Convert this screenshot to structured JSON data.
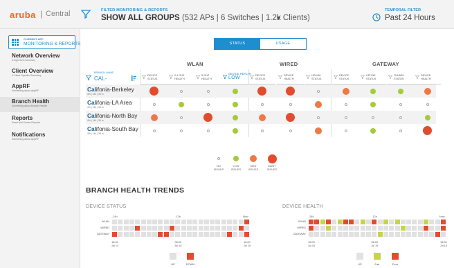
{
  "brand": {
    "logo": "aruba",
    "separator": "|",
    "product": "Central"
  },
  "header": {
    "filter_title": "FILTER MONITORING & REPORTS",
    "filter_main": "SHOW ALL GROUPS",
    "filter_detail": "(532 APs | 6 Switches | 1.2k Clients)",
    "filter_caret": "▼",
    "time_title": "TEMPORAL FILTER",
    "time_main": "Past 24 Hours"
  },
  "sidebar": {
    "app_button": {
      "sub": "CURRENT APP",
      "label": "MONITORING & REPORTS"
    },
    "items": [
      {
        "title": "Network Overview",
        "sub": "A high level summary"
      },
      {
        "title": "Client Overview",
        "sub": "A Client Specific Summary"
      },
      {
        "title": "AppRF",
        "sub": "Something about AppRF"
      },
      {
        "title": "Branch Health",
        "sub": "Something about Branch Health"
      },
      {
        "title": "Reports",
        "sub": "Read and Create Reports"
      },
      {
        "title": "Notifications",
        "sub": "Something about AppRF"
      }
    ]
  },
  "tabs": {
    "status": "STATUS",
    "usage": "USAGE"
  },
  "groups": {
    "wlan": "WLAN",
    "wired": "WIRED",
    "gateway": "GATEWAY"
  },
  "table": {
    "branch_header": {
      "label": "BRANCH NAME",
      "value": "CAL-"
    },
    "columns": [
      {
        "line1": "DEVICE",
        "line2": "STATUS",
        "highlight": false
      },
      {
        "line1": "2.4 GHZ",
        "line2": "HEALTH",
        "highlight": false
      },
      {
        "line1": "5 GHZ",
        "line2": "HEALTH",
        "highlight": false
      },
      {
        "line1": "DEVICE HEALTH",
        "line2": "LOW",
        "highlight": true
      },
      {
        "line1": "DEVICE",
        "line2": "STATUS",
        "highlight": false
      },
      {
        "line1": "DEVICE",
        "line2": "HEALTH",
        "highlight": false
      },
      {
        "line1": "UPLINK",
        "line2": "STATUS",
        "highlight": false
      },
      {
        "line1": "DEVICE",
        "line2": "STATUS",
        "highlight": false
      },
      {
        "line1": "UPLINK",
        "line2": "STATUS",
        "highlight": false
      },
      {
        "line1": "TUNNEL",
        "line2": "STATUS",
        "highlight": false
      },
      {
        "line1": "DEVICE",
        "line2": "HEALTH",
        "highlight": false
      }
    ],
    "rows": [
      {
        "prefix": "Cal",
        "name": "ifonia-Berkeley",
        "meta": "4% | 14h | 35 m",
        "cells": [
          "many",
          "none",
          "none",
          "low",
          "many",
          "many",
          "none",
          "med",
          "low",
          "low",
          "med"
        ]
      },
      {
        "prefix": "Cal",
        "name": "ifonia-LA Area",
        "meta": "4% | 14h | 35 m",
        "cells": [
          "none",
          "low",
          "none",
          "low",
          "none",
          "none",
          "med",
          "none",
          "low",
          "none",
          "none"
        ]
      },
      {
        "prefix": "Cal",
        "name": "ifonia-North Bay",
        "meta": "4% | 14h | 35 m",
        "cells": [
          "med",
          "none",
          "many",
          "low",
          "med",
          "many",
          "none",
          "none",
          "none",
          "none",
          "low"
        ]
      },
      {
        "prefix": "Cal",
        "name": "ifonia-South Bay",
        "meta": "4% | 14h | 35 m",
        "cells": [
          "none",
          "none",
          "none",
          "low",
          "none",
          "none",
          "med",
          "none",
          "low",
          "none",
          "many"
        ]
      }
    ]
  },
  "legend": [
    {
      "level": "none",
      "line1": "NO",
      "line2": "ISSUES"
    },
    {
      "level": "low",
      "line1": "LOW",
      "line2": "ISSUES"
    },
    {
      "level": "med",
      "line1": "MED",
      "line2": "ISSUES"
    },
    {
      "level": "many",
      "line1": "MANY",
      "line2": "ISSUES"
    }
  ],
  "trends": {
    "title": "BRANCH HEALTH TRENDS",
    "device_status": {
      "title": "DEVICE STATUS",
      "timeline": {
        "start": "-24h",
        "mid": "-12h",
        "end": "Now"
      },
      "rows": [
        {
          "label": "WLAN",
          "cells": [
            "u",
            "u",
            "u",
            "u",
            "u",
            "u",
            "u",
            "u",
            "u",
            "u",
            "u",
            "u",
            "u",
            "u",
            "u",
            "u",
            "u",
            "u",
            "u",
            "u",
            "u",
            "u",
            "u",
            "d"
          ]
        },
        {
          "label": "WIRED",
          "cells": [
            "u",
            "u",
            "u",
            "u",
            "d",
            "u",
            "u",
            "u",
            "u",
            "u",
            "d",
            "u",
            "u",
            "u",
            "u",
            "u",
            "u",
            "u",
            "u",
            "u",
            "u",
            "u",
            "d",
            "u"
          ]
        },
        {
          "label": "GATEWAY",
          "cells": [
            "d",
            "u",
            "u",
            "u",
            "u",
            "u",
            "u",
            "u",
            "d",
            "d",
            "u",
            "u",
            "u",
            "u",
            "u",
            "u",
            "u",
            "u",
            "u",
            "u",
            "d",
            "u",
            "u",
            "d"
          ]
        }
      ],
      "axis": [
        {
          "time": "18:00",
          "date": "Jul 14"
        },
        {
          "time": "06:00",
          "date": "Jul 15"
        },
        {
          "time": "18:00",
          "date": "Jul 15"
        }
      ],
      "legend": [
        {
          "key": "u",
          "label": "UP",
          "color": "#e1e1e1"
        },
        {
          "key": "d",
          "label": "DOWN",
          "color": "#e34b2e"
        }
      ]
    },
    "device_health": {
      "title": "DEVICE HEALTH",
      "timeline": {
        "start": "-24h",
        "mid": "-12h",
        "end": "Now"
      },
      "rows": [
        {
          "label": "WLAN",
          "cells": [
            "p",
            "p",
            "f",
            "p",
            "u",
            "f",
            "p",
            "p",
            "u",
            "f",
            "u",
            "p",
            "u",
            "f",
            "u",
            "f",
            "u",
            "u",
            "u",
            "u",
            "f",
            "u",
            "u",
            "p"
          ]
        },
        {
          "label": "WIRED",
          "cells": [
            "p",
            "u",
            "u",
            "f",
            "u",
            "u",
            "u",
            "u",
            "u",
            "u",
            "u",
            "u",
            "u",
            "u",
            "u",
            "u",
            "f",
            "u",
            "u",
            "u",
            "p",
            "u",
            "u",
            "p"
          ]
        },
        {
          "label": "GATEWAY",
          "cells": [
            "u",
            "u",
            "u",
            "u",
            "u",
            "u",
            "u",
            "u",
            "u",
            "u",
            "u",
            "u",
            "f",
            "u",
            "u",
            "u",
            "u",
            "u",
            "u",
            "u",
            "u",
            "u",
            "p",
            "u"
          ]
        }
      ],
      "axis": [
        {
          "time": "18:00",
          "date": "Jul 14"
        },
        {
          "time": "06:00",
          "date": "Jul 15"
        },
        {
          "time": "18:00",
          "date": "Jul 15"
        }
      ],
      "legend": [
        {
          "key": "u",
          "label": "UP",
          "color": "#e1e1e1"
        },
        {
          "key": "f",
          "label": "Fair",
          "color": "#c5d44a"
        },
        {
          "key": "p",
          "label": "Poor",
          "color": "#e34b2e"
        }
      ]
    }
  },
  "colors": {
    "accent": "#1f8ecf",
    "brand": "#f26522",
    "low": "#a6ca3c",
    "med": "#ee7946",
    "many": "#e34b2e"
  }
}
